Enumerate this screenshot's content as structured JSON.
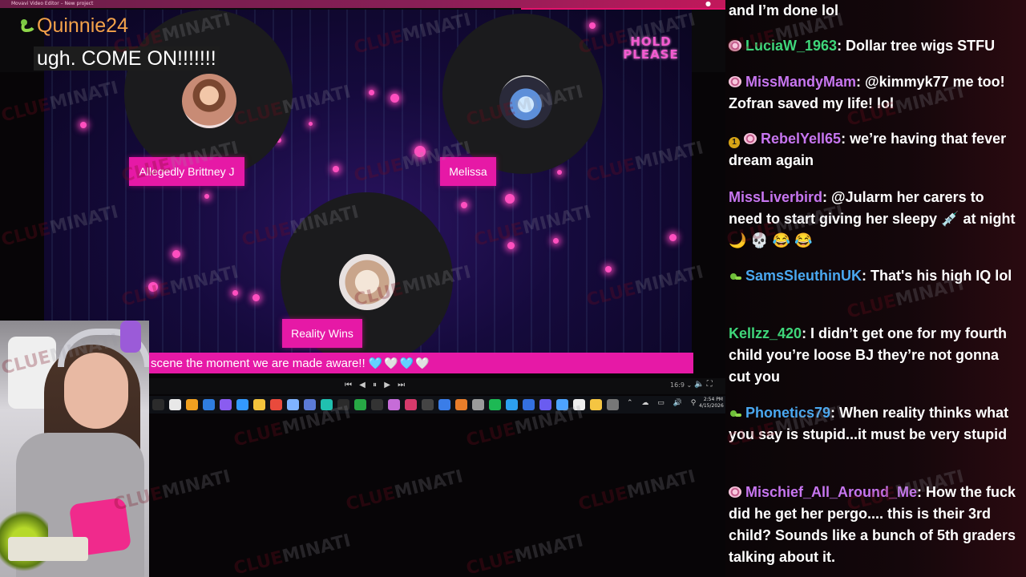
{
  "window": {
    "title": "Movavi Video Editor – New project"
  },
  "alert": {
    "username": "Quinnie24",
    "message": "ugh. COME ON!!!!!!!"
  },
  "preview": {
    "hold_line1": "HOLD",
    "hold_line2": "PLEASE",
    "speakers": [
      {
        "name": "Allegedly Brittney J"
      },
      {
        "name": "Melissa"
      },
      {
        "name": "Reality Wins"
      }
    ],
    "ticker_text": "scene the moment we are made aware!!",
    "ticker_hearts": "🩵🤍🩵🤍"
  },
  "player": {
    "controls": "⏮ ◀ ⏸ ▶ ⏭",
    "aspect": "16:9 ⌄",
    "volume_icon": "🔈 ⛶"
  },
  "taskbar": {
    "time": "2:54 PM",
    "date": "4/15/2026",
    "tray": "⌃ ☁ ▭ 🔊 ⚲"
  },
  "watermark": {
    "part1": "CLUE",
    "part2": "MINATI"
  },
  "chat": {
    "messages": [
      {
        "badge": "none",
        "nick": "",
        "nick_color": "#ffffff",
        "text": "and I’m done lol"
      },
      {
        "badge": "spiral",
        "nick": "LuciaW_1963",
        "nick_color": "#3fd67a",
        "text": ": Dollar tree wigs STFU"
      },
      {
        "badge": "spiral",
        "nick": "MissMandyMam",
        "nick_color": "#c776f0",
        "text": ": @kimmyk77 me too! Zofran saved my life! lol"
      },
      {
        "badge": "gold",
        "badge_text": "1",
        "badge2": "spiral",
        "nick": "RebelYell65",
        "nick_color": "#c776f0",
        "text": ": we’re having that fever dream again"
      },
      {
        "badge": "none",
        "nick": "MissLiverbird",
        "nick_color": "#c776f0",
        "text": ": @Jularm her carers to need to start giving her sleepy 💉 at night 🌙 💀 😂 😂"
      },
      {
        "badge": "snake",
        "nick": "SamsSleuthinUK",
        "nick_color": "#4aa8f0",
        "text": ": That's his high IQ lol"
      },
      {
        "badge": "none",
        "nick": "Kellzz_420",
        "nick_color": "#3fd67a",
        "text": ": I didn’t get one for my fourth child you’re loose BJ they’re not gonna cut you"
      },
      {
        "badge": "snake",
        "nick": "Phonetics79",
        "nick_color": "#4aa8f0",
        "text": ": When reality thinks what you say is stupid...it must be very stupid"
      },
      {
        "badge": "spiral",
        "nick": "Mischief_All_Around_Me",
        "nick_color": "#c776f0",
        "text": ": How the fuck did he get her pergo.... this is their 3rd child? Sounds like a bunch of 5th graders talking about it."
      }
    ]
  }
}
